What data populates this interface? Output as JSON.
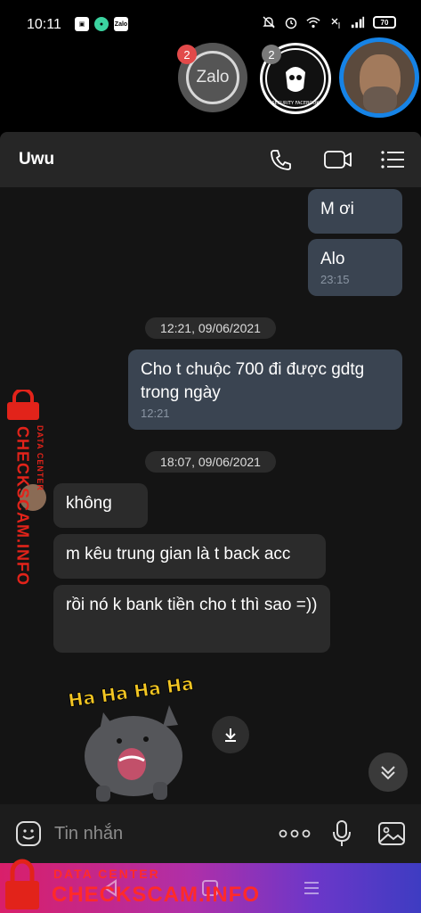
{
  "status_bar": {
    "time": "10:11",
    "battery": "70",
    "icons_left": [
      "bag-icon",
      "chat-icon",
      "zalo-icon"
    ],
    "icons_right": [
      "mute-icon",
      "alarm-icon",
      "wifi-icon",
      "no-signal-icon",
      "signal-icon",
      "battery-icon"
    ]
  },
  "chat_heads": {
    "zalo_label": "Zalo",
    "zalo_badge": "2",
    "security_badge": "2",
    "security_text": "SECURITY FACEBOOK"
  },
  "header": {
    "title": "Uwu"
  },
  "messages": [
    {
      "direction": "out",
      "text": "M ơi",
      "time": ""
    },
    {
      "direction": "out",
      "text": "Alo",
      "time": "23:15"
    },
    {
      "direction": "out",
      "text": "Cho t chuộc 700 đi được gdtg trong ngày",
      "time": "12:21"
    },
    {
      "direction": "in",
      "text": "không",
      "time": ""
    },
    {
      "direction": "in",
      "text": "m kêu trung gian là t back acc",
      "time": ""
    },
    {
      "direction": "in",
      "text": "rồi nó k bank tiền cho t thì sao =))",
      "time": ""
    }
  ],
  "date_separators": [
    "12:21, 09/06/2021",
    "18:07, 09/06/2021"
  ],
  "sticker": {
    "text": "Ha Ha Ha Ha"
  },
  "input": {
    "placeholder": "Tin nhắn"
  },
  "watermark": {
    "main": "CHECKSCAM.INFO",
    "sub": "DATA CENTER"
  },
  "colors": {
    "outgoing_bubble": "#3a4451",
    "incoming_bubble": "#2b2b2b",
    "active_ring": "#1683e6",
    "watermark": "#e2231a"
  }
}
